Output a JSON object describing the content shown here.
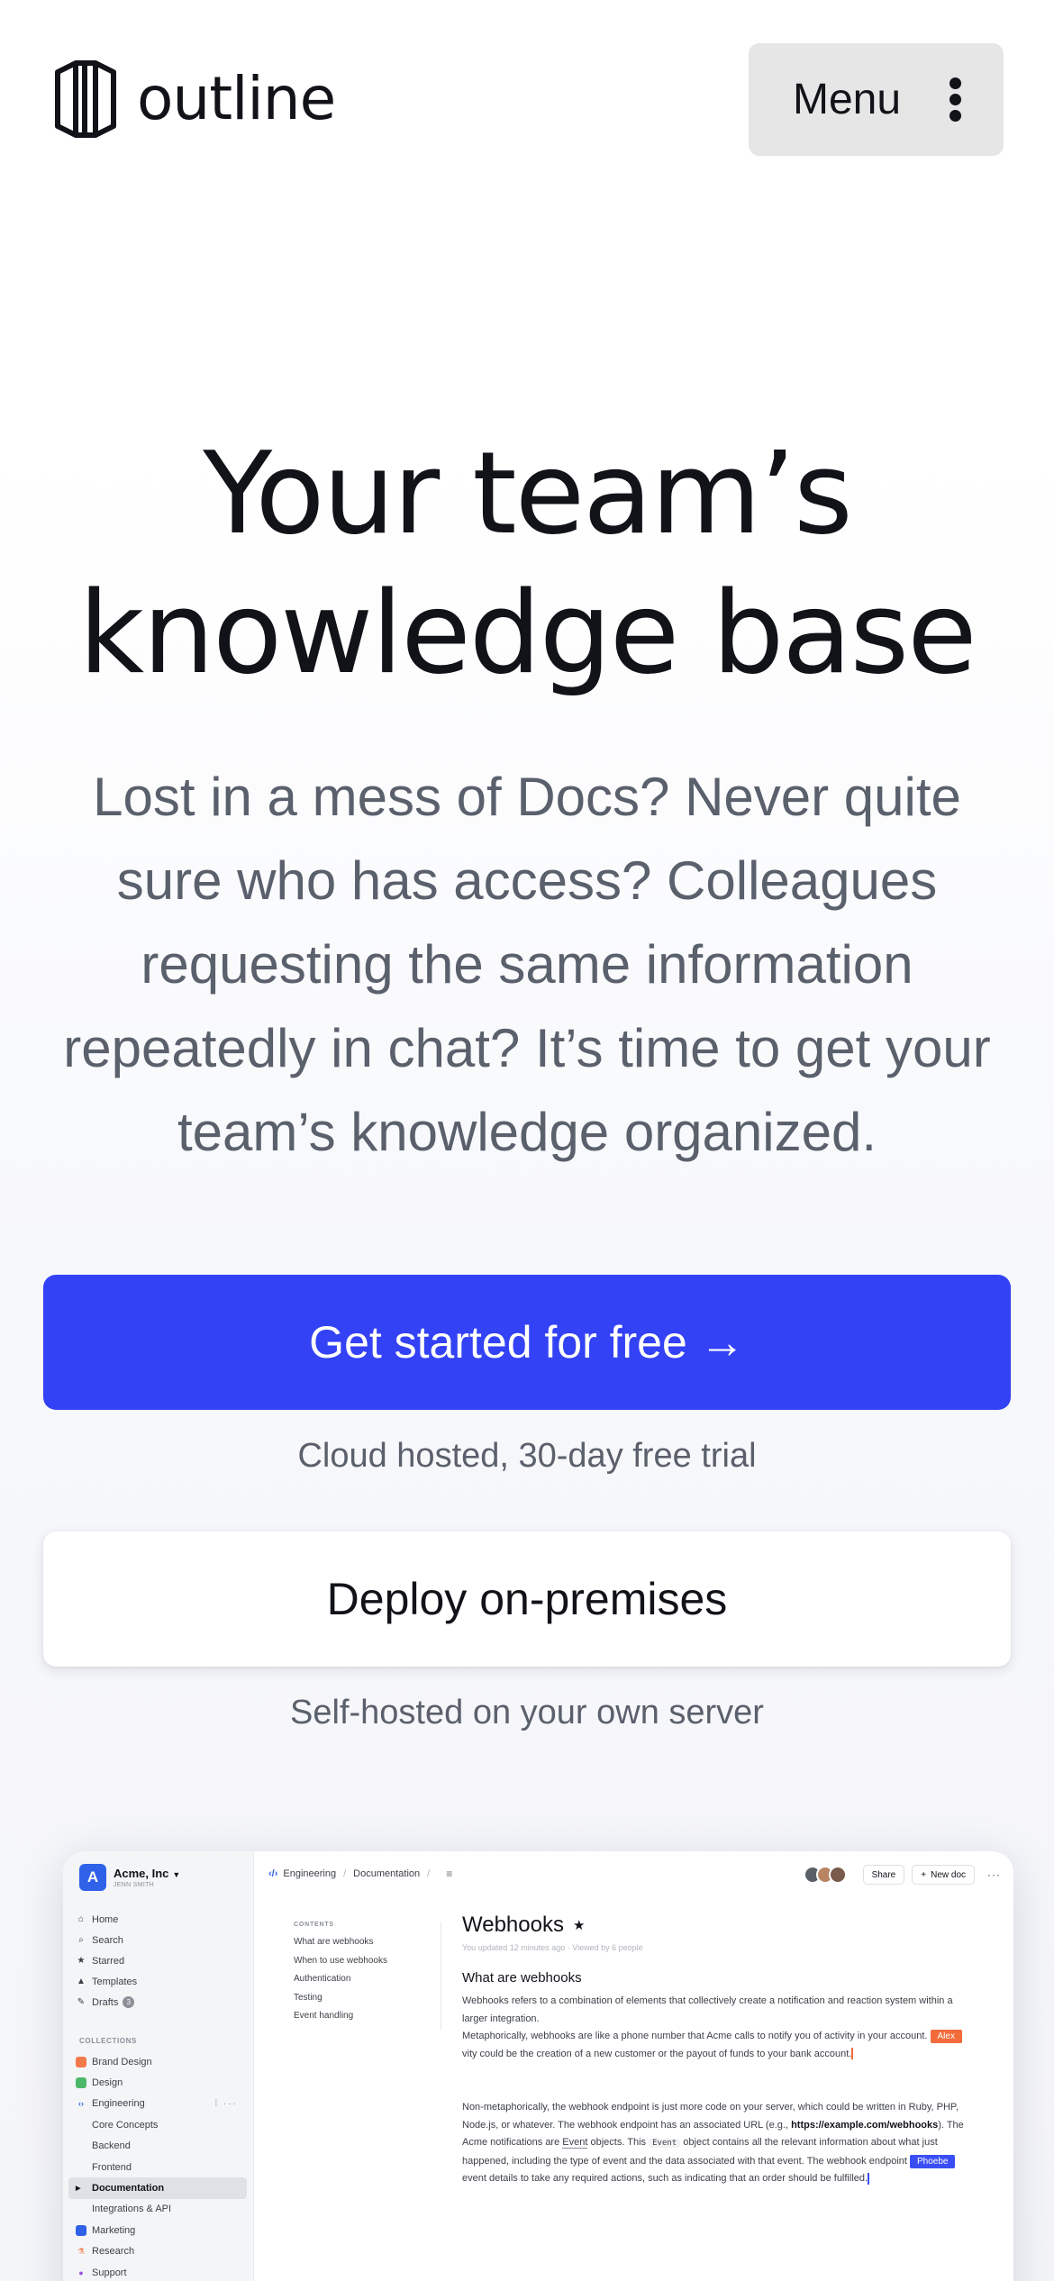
{
  "header": {
    "logo_text": "outline",
    "menu_label": "Menu"
  },
  "hero": {
    "title_line1": "Your team’s",
    "title_line2": "knowledge base",
    "subtitle": "Lost in a mess of Docs? Never quite sure who has access? Colleagues requesting the same information repeatedly in chat? It’s time to get your team’s knowledge organized."
  },
  "cta": {
    "primary_label": "Get started for free",
    "primary_arrow": "→",
    "primary_note": "Cloud hosted, 30-day free trial",
    "secondary_label": "Deploy on-premises",
    "secondary_note": "Self-hosted on your own server"
  },
  "colors": {
    "accent": "#3342f5",
    "menu_bg": "#e6e6e6",
    "cursor_alex": "#f26b3a",
    "cursor_phoebe": "#3a4ef5"
  },
  "app": {
    "team_initial": "A",
    "team_name": "Acme, Inc",
    "team_user": "JENN SMITH",
    "nav": [
      {
        "label": "Home",
        "icon": "home-icon"
      },
      {
        "label": "Search",
        "icon": "search-icon"
      },
      {
        "label": "Starred",
        "icon": "star-icon"
      },
      {
        "label": "Templates",
        "icon": "shapes-icon"
      },
      {
        "label": "Drafts",
        "icon": "pencil-icon",
        "count": "3"
      }
    ],
    "collections_heading": "COLLECTIONS",
    "collections": [
      {
        "label": "Brand Design"
      },
      {
        "label": "Design"
      },
      {
        "label": "Engineering"
      },
      {
        "label": "Core Concepts"
      },
      {
        "label": "Backend"
      },
      {
        "label": "Frontend"
      },
      {
        "label": "Documentation"
      },
      {
        "label": "Integrations & API"
      },
      {
        "label": "Marketing"
      },
      {
        "label": "Research"
      },
      {
        "label": "Support"
      }
    ],
    "breadcrumb": [
      "Engineering",
      "Documentation"
    ],
    "share_label": "Share",
    "new_doc_label": "New doc",
    "toc_heading": "CONTENTS",
    "toc": [
      "What are webhooks",
      "When to use webhooks",
      "Authentication",
      "Testing",
      "Event handling"
    ],
    "doc_title": "Webhooks",
    "doc_meta": "You updated 12 minutes ago · Viewed by 6 people",
    "doc_h2": "What are webhooks",
    "p1": "Webhooks refers to a combination of elements that collectively create a notification and reaction system within a larger integration.",
    "p2a": "Metaphorically, webhooks are like a phone number that Acme calls to notify you of activity in your account.",
    "p2_cursor": "Alex",
    "p2b": "vity could be the creation of a new customer or the payout of funds to your bank account.",
    "p3a": "Non-metaphorically, the webhook endpoint is just more code on your server, which could be written in Ruby, PHP, Node.js, or whatever. The webhook endpoint has an associated URL (e.g.,",
    "p3_url": "https://example.com/webhooks",
    "p3b": "). The Acme notifications are",
    "p3_event": "Event",
    "p3c": "objects. This",
    "p3_code": "Event",
    "p3d": "object contains all the relevant information about what just happened, including the type of event and the data associated with that event. The webhook endpoint",
    "p3_cursor": "Phoebe",
    "p3e": "event details to take any required actions, such as indicating that an order should be fulfilled."
  }
}
